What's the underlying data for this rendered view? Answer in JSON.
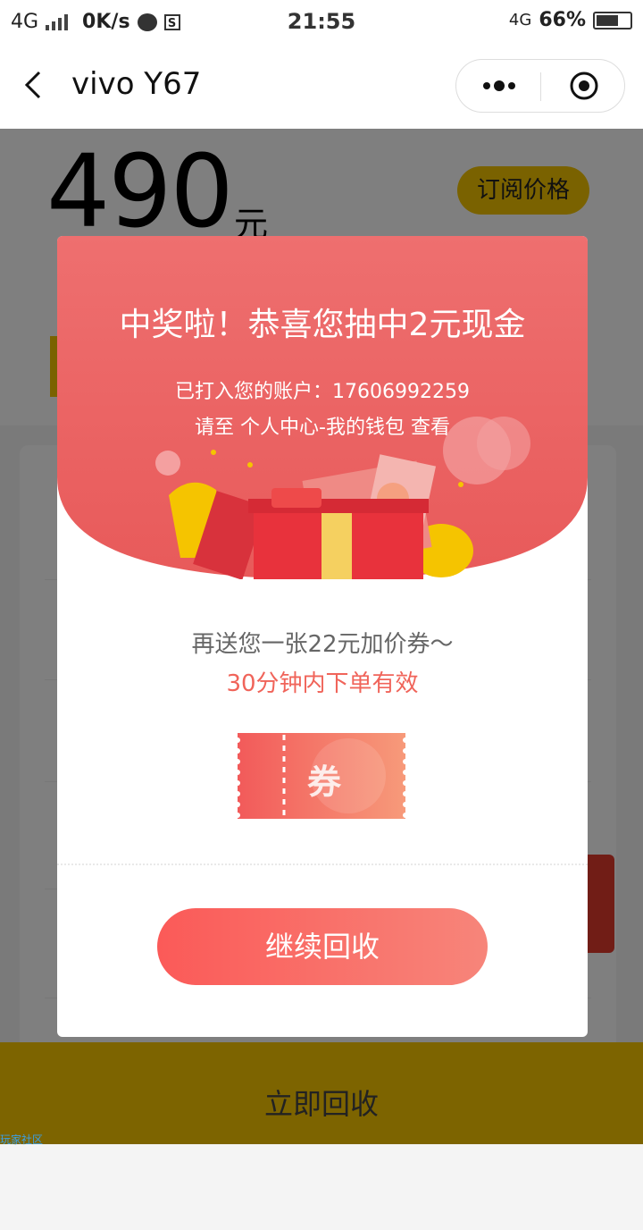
{
  "status_bar": {
    "network": "4G",
    "speed": "0K/s",
    "time": "21:55",
    "network_right": "4G",
    "battery": "66%",
    "battery_level": 0.66
  },
  "nav": {
    "title": "vivo Y67"
  },
  "page": {
    "price": "490",
    "price_unit": "元",
    "subscribe_label": "订阅价格",
    "recycle_label": "立即回收",
    "watermark": "玩家社区"
  },
  "modal": {
    "headline": "中奖啦！恭喜您抽中2元现金",
    "account_line": "已打入您的账户：17606992259",
    "wallet_hint": "请至 个人中心-我的钱包 查看",
    "bonus_line": "再送您一张22元加价券～",
    "validity_line": "30分钟内下单有效",
    "coupon_label": "券",
    "continue_label": "继续回收"
  },
  "colors": {
    "accent_yellow": "#f5c400",
    "modal_red": "#f06a6a",
    "button_red": "#fb5a58"
  }
}
